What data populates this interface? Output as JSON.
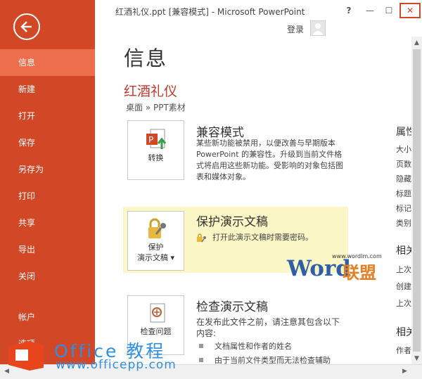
{
  "window": {
    "title": "红酒礼仪.ppt [兼容模式] - Microsoft PowerPoint",
    "help_label": "?",
    "min_label": "—",
    "max_label": "☐",
    "close_label": "✕",
    "login_label": "登录"
  },
  "sidebar": {
    "items": [
      {
        "label": "信息"
      },
      {
        "label": "新建"
      },
      {
        "label": "打开"
      },
      {
        "label": "保存"
      },
      {
        "label": "另存为"
      },
      {
        "label": "打印"
      },
      {
        "label": "共享"
      },
      {
        "label": "导出"
      },
      {
        "label": "关闭"
      },
      {
        "label": "帐户"
      },
      {
        "label": "选项"
      }
    ]
  },
  "main": {
    "page_title": "信息",
    "doc_name": "红酒礼仪",
    "breadcrumb": "桌面 » PPT素材",
    "compat": {
      "button_label": "转换",
      "title": "兼容模式",
      "desc": "某些新功能被禁用，以便改善与早期版本 PowerPoint 的兼容性。升级到当前文件格式将启用这些新功能。受影响的对象包括图表和媒体对象。"
    },
    "protect": {
      "button_line1": "保护",
      "button_line2": "演示文稿",
      "title": "保护演示文稿",
      "desc": "打开此演示文稿时需要密码。"
    },
    "inspect": {
      "button_label": "检查问题",
      "title": "检查演示文稿",
      "desc": "在发布此文件之前，请注意其包含以下内容:",
      "bullets": [
        "文档属性和作者的姓名",
        "由于当前文件类型而无法检查辅助"
      ]
    }
  },
  "right_column": {
    "h1": "属性",
    "items1": [
      "大小",
      "页数",
      "隐藏",
      "标题",
      "标记",
      "类别"
    ],
    "h2": "相关日期",
    "items2": [
      "上次修改时间",
      "创建时间",
      "上次打印时间"
    ],
    "h3": "相关人员",
    "items3": [
      "作者"
    ]
  },
  "watermarks": {
    "word": "Word",
    "word_url": "www.wordlm.com",
    "lianmeng": "联盟",
    "office": "Office 教程",
    "office_url": "www.officepp.com"
  },
  "colors": {
    "sidebar_bg": "#d24726",
    "sidebar_active": "#ec6e4c",
    "doc_name": "#c0392b",
    "highlight": "#fbf6c5"
  }
}
